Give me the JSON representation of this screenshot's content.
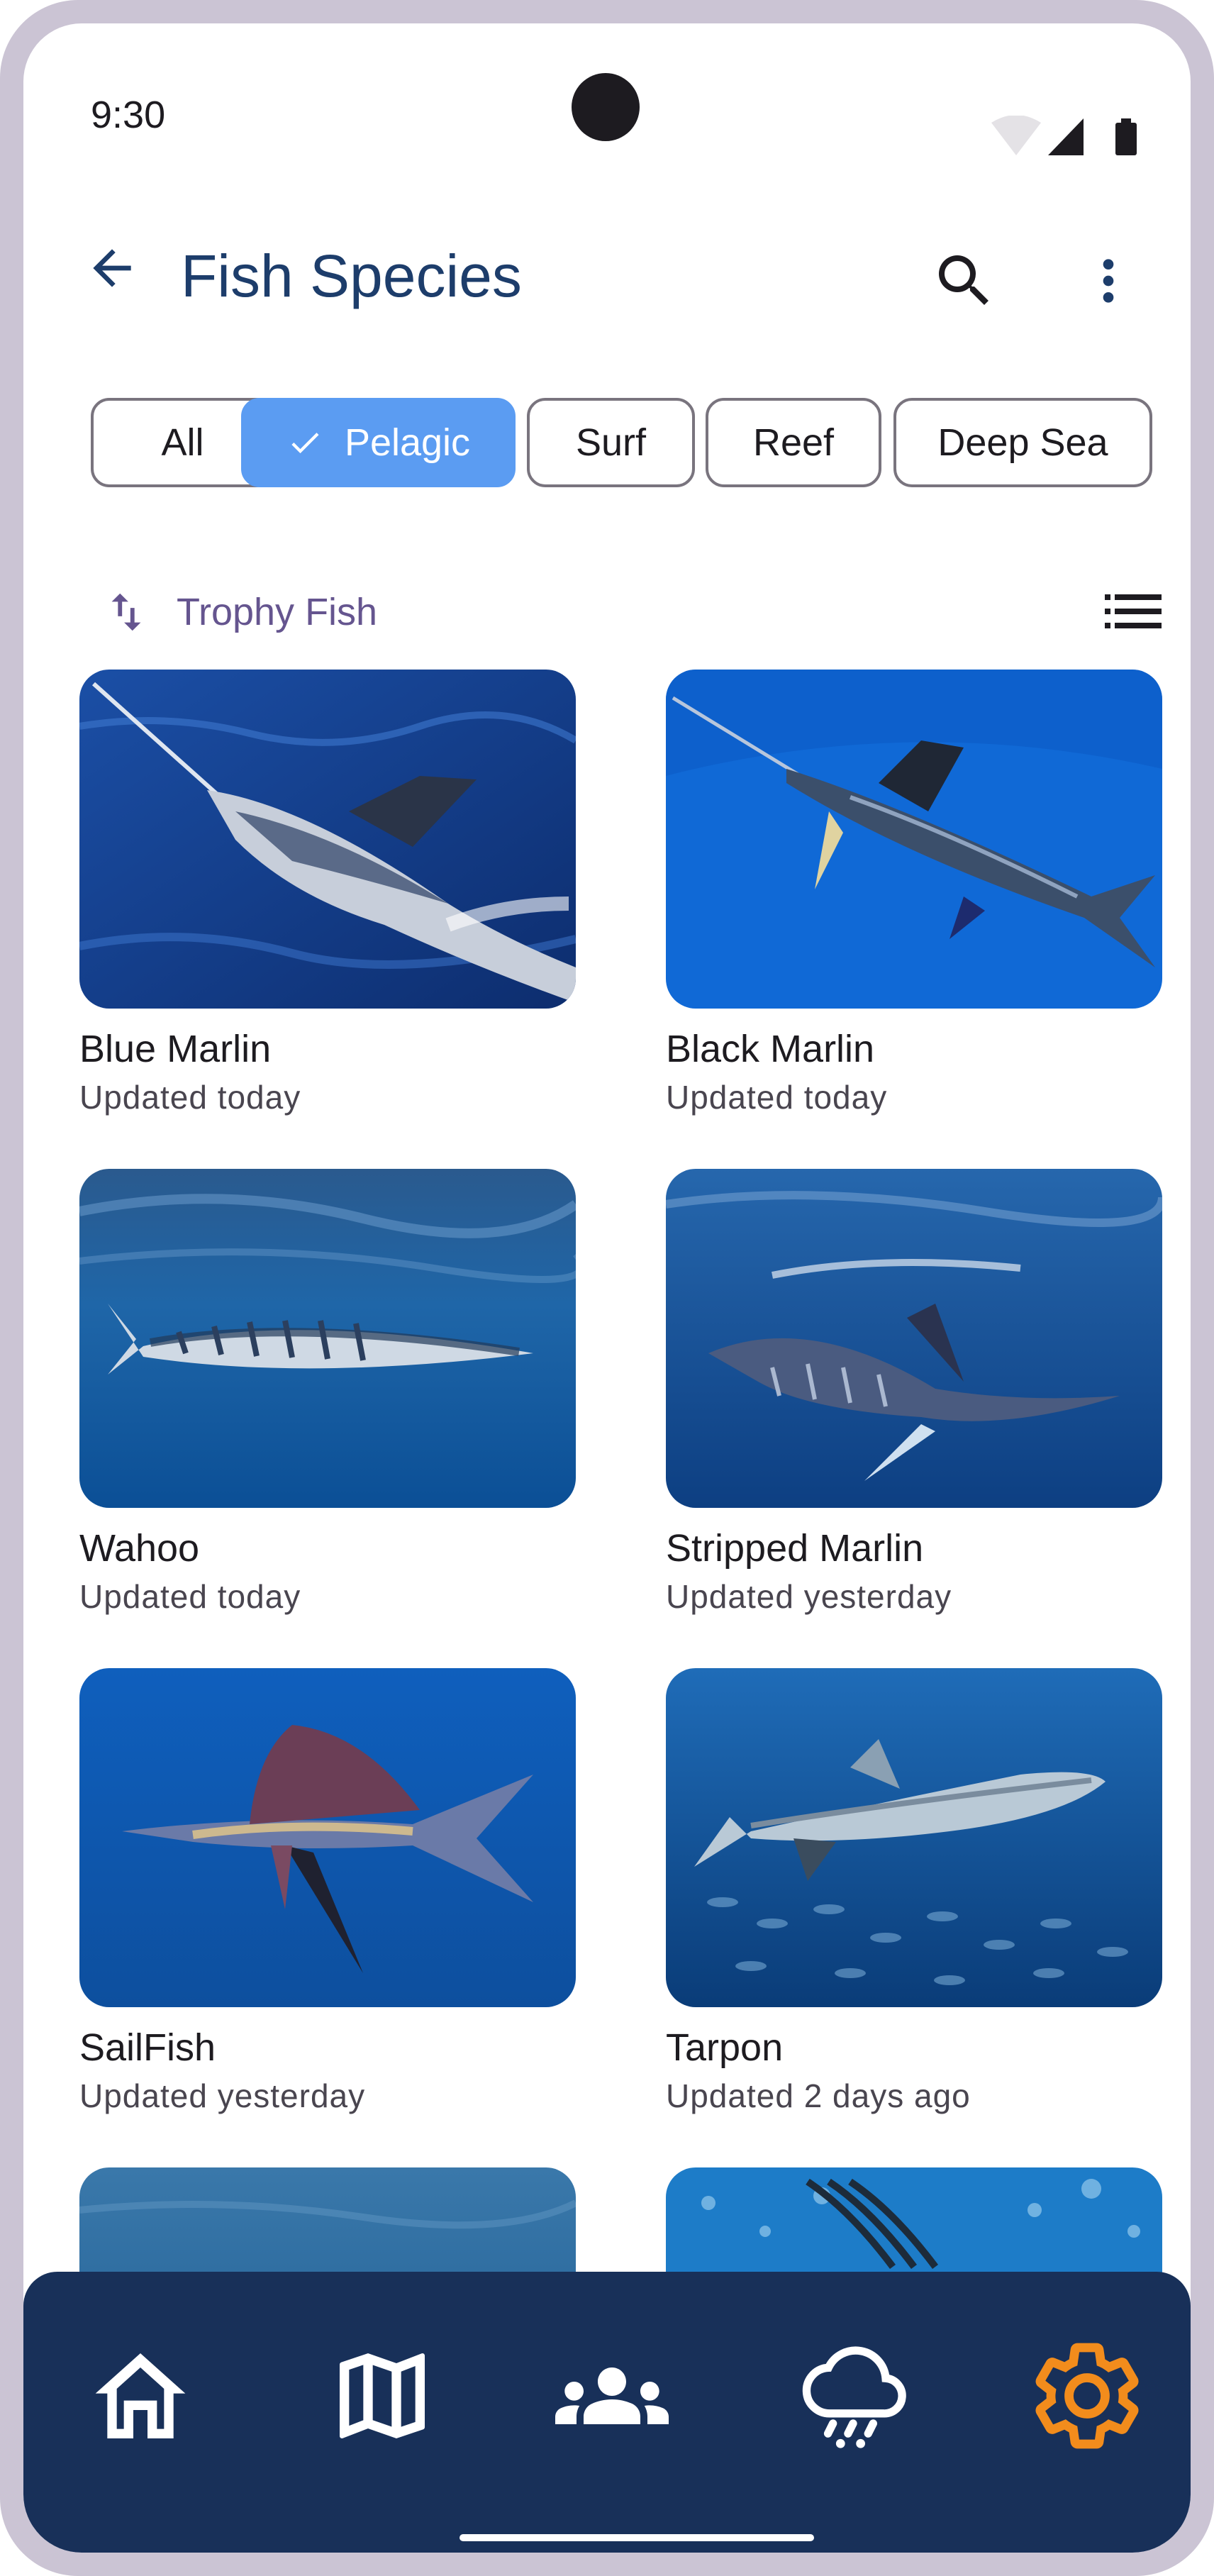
{
  "status_bar": {
    "time": "9:30"
  },
  "app_bar": {
    "title": "Fish Species"
  },
  "filters": {
    "chips": [
      "All",
      "Pelagic",
      "Surf",
      "Reef",
      "Deep Sea"
    ],
    "selected": "Pelagic"
  },
  "sort": {
    "label": "Trophy Fish"
  },
  "species": [
    {
      "name": "Blue Marlin",
      "updated": "Updated today"
    },
    {
      "name": "Black Marlin",
      "updated": "Updated today"
    },
    {
      "name": "Wahoo",
      "updated": "Updated today"
    },
    {
      "name": "Stripped Marlin",
      "updated": "Updated yesterday"
    },
    {
      "name": "SailFish",
      "updated": "Updated yesterday"
    },
    {
      "name": "Tarpon",
      "updated": "Updated 2 days ago"
    }
  ],
  "bottom_nav": {
    "items": [
      "home-icon",
      "map-icon",
      "community-icon",
      "weather-icon",
      "settings-icon"
    ],
    "active": "settings-icon",
    "colors": {
      "background": "#183059",
      "active": "#f28c1c",
      "inactive": "#ffffff"
    }
  },
  "colors": {
    "accent": "#5b9cf2",
    "title": "#1d3d6b",
    "sort_label": "#65558f"
  }
}
